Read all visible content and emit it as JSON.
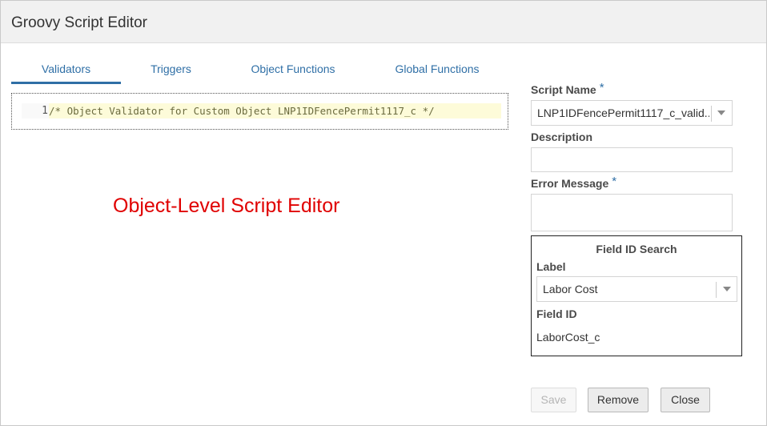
{
  "window": {
    "title": "Groovy Script Editor"
  },
  "tabs": [
    {
      "label": "Validators",
      "active": true
    },
    {
      "label": "Triggers",
      "active": false
    },
    {
      "label": "Object Functions",
      "active": false
    },
    {
      "label": "Global Functions",
      "active": false
    }
  ],
  "editor": {
    "line_number": "1",
    "code": "/* Object Validator for Custom Object LNP1IDFencePermit1117_c */"
  },
  "annotation": {
    "text": "Object-Level Script Editor"
  },
  "form": {
    "script_name_label": "Script Name",
    "required_marker": "*",
    "script_name_value": "LNP1IDFencePermit1117_c_valid...",
    "description_label": "Description",
    "description_value": "",
    "error_message_label": "Error Message",
    "error_message_value": ""
  },
  "field_search": {
    "title": "Field ID Search",
    "label_label": "Label",
    "label_value": "Labor Cost",
    "field_id_label": "Field ID",
    "field_id_value": "LaborCost_c"
  },
  "buttons": {
    "save": "Save",
    "remove": "Remove",
    "close": "Close"
  },
  "colors": {
    "accent": "#2f6fa6",
    "annotation": "#e00000",
    "code_highlight": "#fdfbd9"
  }
}
